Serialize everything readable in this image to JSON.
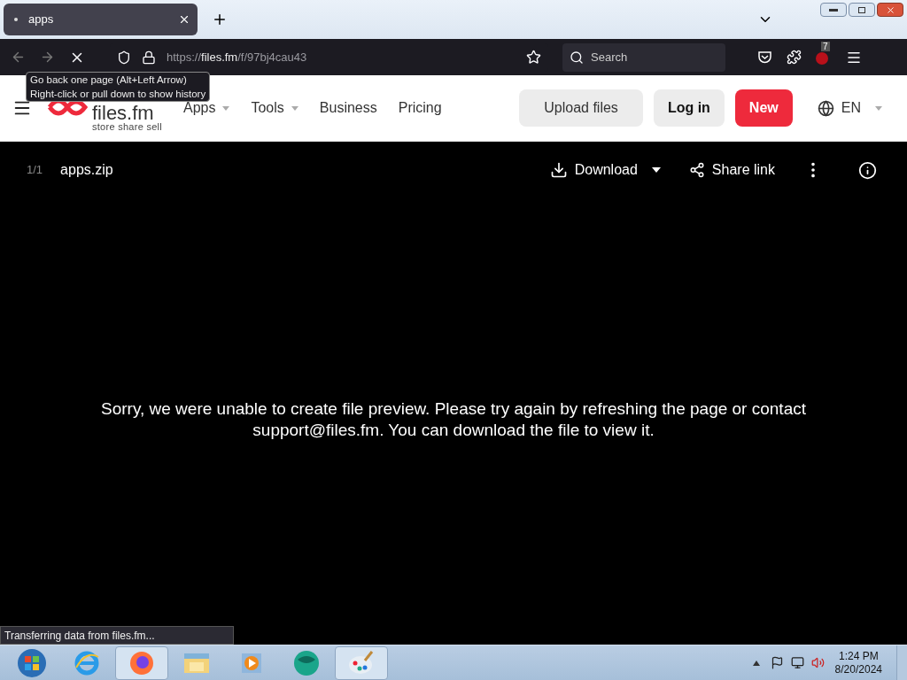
{
  "browser": {
    "tabs": [
      {
        "title": "apps",
        "selected": true,
        "loading": true
      }
    ],
    "url_host": "files.fm",
    "url_prefix": "https://",
    "url_path": "/f/97bj4cau43",
    "search_placeholder": "Search",
    "extension_badge": "7",
    "tooltip": [
      "Go back one page (Alt+Left Arrow)",
      "Right-click or pull down to show history"
    ],
    "status": "Transferring data from files.fm..."
  },
  "site": {
    "logo": "files.fm",
    "tagline": "store share sell",
    "nav": [
      {
        "label": "Apps",
        "dropdown": true
      },
      {
        "label": "Tools",
        "dropdown": true
      },
      {
        "label": "Business",
        "dropdown": false
      },
      {
        "label": "Pricing",
        "dropdown": false
      }
    ],
    "buttons": [
      {
        "label": "Upload files",
        "kind": "secondary"
      },
      {
        "label": "Log in",
        "kind": "login"
      },
      {
        "label": "New",
        "kind": "primary"
      }
    ],
    "language": "EN"
  },
  "viewer": {
    "counter": "1/1",
    "filename": "apps.zip",
    "download": "Download",
    "share": "Share link",
    "message": "Sorry, we were unable to create file preview. Please try again by refreshing the page or contact support@files.fm. You can download the file to view it."
  },
  "taskbar": {
    "apps": [
      {
        "kind": "start",
        "open": false
      },
      {
        "kind": "ie",
        "open": false
      },
      {
        "kind": "firefox",
        "open": true
      },
      {
        "kind": "explorer",
        "open": false
      },
      {
        "kind": "media",
        "open": false
      },
      {
        "kind": "globe",
        "open": false
      },
      {
        "kind": "paint",
        "open": true
      }
    ],
    "time": "1:24 PM",
    "date": "8/20/2024"
  }
}
